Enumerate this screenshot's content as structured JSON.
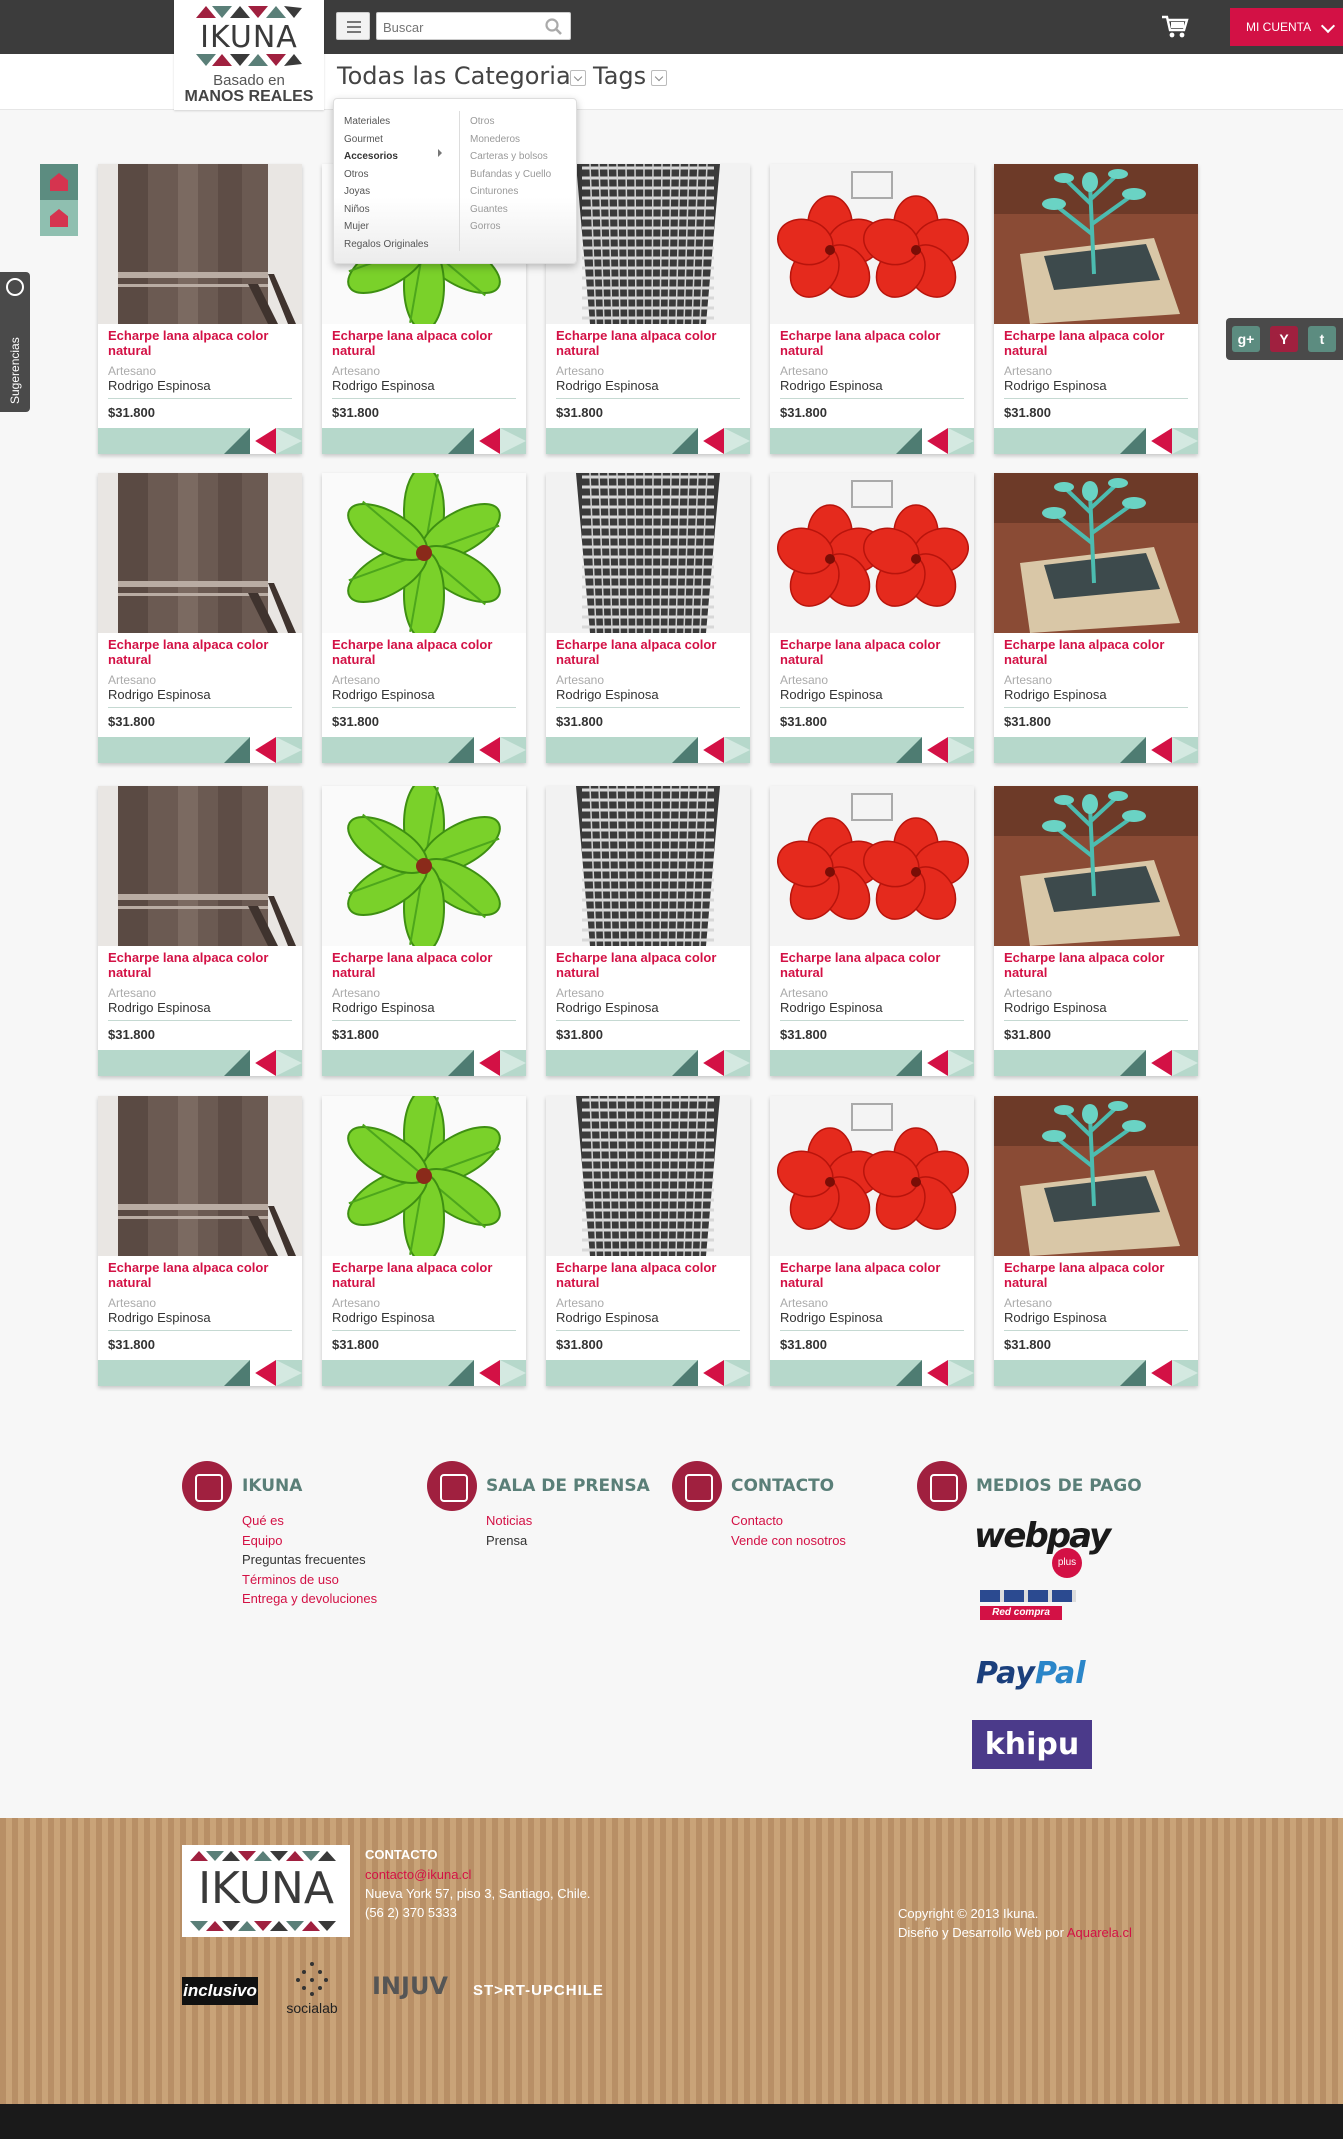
{
  "header": {
    "logo_text": "IKUNA",
    "logo_sub1": "Basado en",
    "logo_sub2": "MANOS REALES",
    "search_placeholder": "Buscar",
    "account_label": "MI CUENTA",
    "categories_label": "Todas las Categorias",
    "tags_label": "Tags"
  },
  "dropdown": {
    "col1": [
      "Materiales",
      "Gourmet",
      "Accesorios",
      "Otros",
      "Joyas",
      "Niños",
      "Mujer",
      "Regalos Originales"
    ],
    "selected": "Accesorios",
    "col2": [
      "Otros",
      "Monederos",
      "Carteras y   bolsos",
      "Bufandas y Cuello",
      "Cinturones",
      "Guantes",
      "Gorros"
    ]
  },
  "side": {
    "sugerencias_label": "Sugerencias",
    "social": [
      "g+",
      "Y",
      "t"
    ]
  },
  "products": [
    {
      "title": "Echarpe lana alpaca color natural",
      "role": "Artesano",
      "artisan": "Rodrigo Espinosa",
      "price": "$31.800",
      "image": "scarf"
    },
    {
      "title": "Echarpe lana alpaca color natural",
      "role": "Artesano",
      "artisan": "Rodrigo Espinosa",
      "price": "$31.800",
      "image": "green-flower"
    },
    {
      "title": "Echarpe lana alpaca color natural",
      "role": "Artesano",
      "artisan": "Rodrigo Espinosa",
      "price": "$31.800",
      "image": "knit-dress"
    },
    {
      "title": "Echarpe lana alpaca color natural",
      "role": "Artesano",
      "artisan": "Rodrigo Espinosa",
      "price": "$31.800",
      "image": "red-flowers"
    },
    {
      "title": "Echarpe lana alpaca color natural",
      "role": "Artesano",
      "artisan": "Rodrigo Espinosa",
      "price": "$31.800",
      "image": "plant-box"
    }
  ],
  "footer": {
    "ikuna_head": "IKUNA",
    "ikuna_links": [
      "Qué es",
      "Equipo",
      "Preguntas frecuentes",
      "Términos de uso",
      "Entrega y devoluciones"
    ],
    "prensa_head": "SALA DE PRENSA",
    "prensa_links": [
      "Noticias",
      "Prensa"
    ],
    "contacto_head": "CONTACTO",
    "contacto_links": [
      "Contacto",
      "Vende con nosotros"
    ],
    "pago_head": "MEDIOS DE PAGO",
    "webpay_label": "webpay",
    "webpay_plus": "plus",
    "redcompra": "Red compra",
    "paypal_a": "Pay",
    "paypal_b": "Pal",
    "khipu": "khipu"
  },
  "bottom": {
    "logo_text": "IKUNA",
    "contact_head": "CONTACTO",
    "email": "contacto@ikuna.cl",
    "address": "Nueva York 57, piso 3, Santiago, Chile.",
    "phone": "(56 2) 370 5333",
    "copyright": "Copyright © 2013 Ikuna.",
    "credits_prefix": "Diseño y Desarrollo Web por ",
    "credits_link": "Aquarela.cl",
    "sponsors": [
      "inclusivo",
      "socialab",
      "INJUV",
      "ST>RT-UPCHILE"
    ]
  },
  "colors": {
    "accent": "#d31145",
    "teal": "#b6d8cb",
    "dark": "#3c3c3c"
  }
}
